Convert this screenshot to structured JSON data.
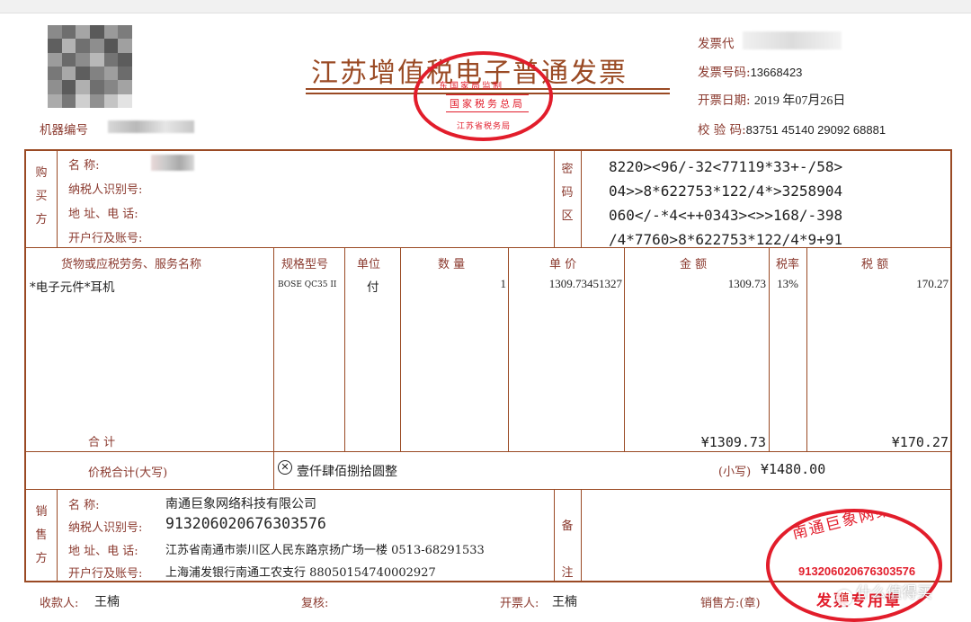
{
  "title": "江苏增值税电子普通发票",
  "seal_top": {
    "line1": "东国家局监制",
    "line2": "国家税务总局",
    "line3": "江苏省税务局"
  },
  "header": {
    "machine_no_label": "机器编号",
    "invoice_code_label": "发票代",
    "invoice_no_label": "发票号码:",
    "invoice_no": "13668423",
    "date_label": "开票日期:",
    "date_value": "2019 年07月26日",
    "check_label": "校 验 码:",
    "check_code": "83751 45140 29092 68881"
  },
  "buyer": {
    "side_label": [
      "购",
      "买",
      "方"
    ],
    "name_label": "名        称:",
    "tax_id_label": "纳税人识别号:",
    "address_label": "地 址、电 话:",
    "bank_label": "开户行及账号:"
  },
  "cipher": {
    "side_label": [
      "密",
      "码",
      "区"
    ],
    "lines": [
      "8220><96/-32<77119*33+-/58>",
      "04>>8*622753*122/4*>3258904",
      "060</-*4<++0343><>>168/-398",
      "/4*7760>8*622753*122/4*9+91"
    ]
  },
  "items": {
    "headers": {
      "name": "货物或应税劳务、服务名称",
      "spec": "规格型号",
      "unit": "单位",
      "qty": "数 量",
      "price": "单 价",
      "amount": "金 额",
      "rate": "税率",
      "tax": "税 额"
    },
    "rows": [
      {
        "name": "*电子元件*耳机",
        "spec": "BOSE QC35 II",
        "unit": "付",
        "qty": "1",
        "price": "1309.73451327",
        "amount": "1309.73",
        "rate": "13%",
        "tax": "170.27"
      }
    ],
    "total_label": "合        计",
    "total_amount": "¥1309.73",
    "total_tax": "¥170.27"
  },
  "grand_total": {
    "label": "价税合计(大写)",
    "upper_icon": "circle-x-icon",
    "upper": "壹仟肆佰捌拾圆整",
    "lower_label": "(小写)",
    "lower": "¥1480.00"
  },
  "seller": {
    "side_label": [
      "销",
      "售",
      "方"
    ],
    "name_label": "名        称:",
    "name": "南通巨象网络科技有限公司",
    "tax_id_label": "纳税人识别号:",
    "tax_id": "913206020676303576",
    "address_label": "地 址、电 话:",
    "address": "江苏省南通市崇川区人民东路京扬广场一楼 0513-68291533",
    "bank_label": "开户行及账号:",
    "bank": "上海浦发银行南通工农支行 88050154740002927"
  },
  "remarks": {
    "side_label": [
      "备",
      "注"
    ]
  },
  "seal_bottom": {
    "line1": "南通巨象网络科技有限公司",
    "line2": "913206020676303576",
    "line3": "发票专用章"
  },
  "footer": {
    "payee_label": "收款人:",
    "payee": "王楠",
    "reviewer_label": "复核:",
    "issuer_label": "开票人:",
    "issuer": "王楠",
    "seller_label": "销售方:(章)"
  },
  "watermark": {
    "icon": "zhi-logo-icon",
    "text": "什么值得买"
  },
  "colors": {
    "frame": "#9a4a24",
    "label": "#8b3a2f",
    "seal": "#e21d2b"
  }
}
